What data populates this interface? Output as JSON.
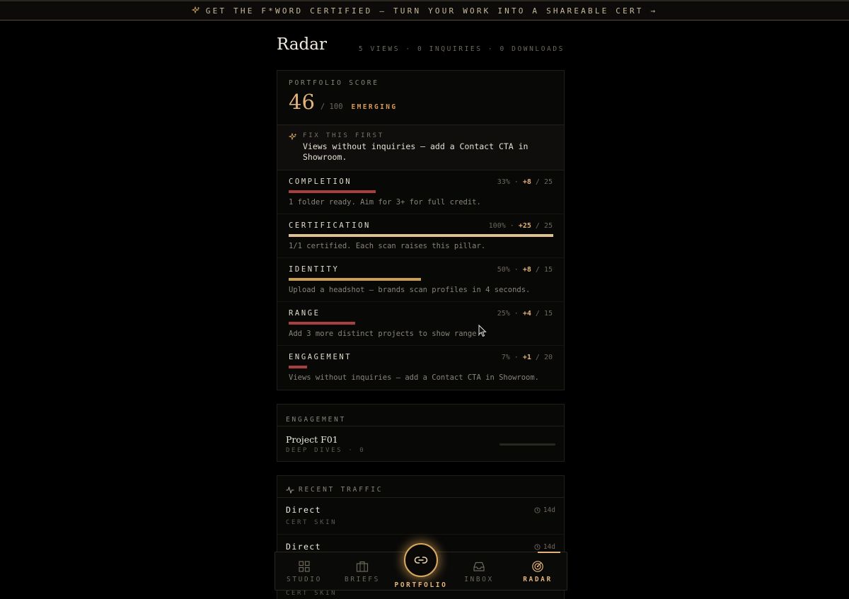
{
  "banner": {
    "text": "GET THE F*WORD CERTIFIED — TURN YOUR WORK INTO A SHAREABLE CERT →",
    "icon": "sparkle-icon"
  },
  "header": {
    "title": "Radar",
    "stats": "5 VIEWS · 0 INQUIRIES · 0 DOWNLOADS"
  },
  "score": {
    "label": "PORTFOLIO SCORE",
    "value": "46",
    "out_of": "/ 100",
    "tier": "EMERGING",
    "fix_label": "FIX THIS FIRST",
    "fix_line1": "Views without inquiries — add a Contact CTA in",
    "fix_line2": "Showroom."
  },
  "pillars": [
    {
      "name": "COMPLETION",
      "pct": "33%",
      "delta": "+8",
      "max": "/ 25",
      "fill": 0.33,
      "color": "#a84040",
      "note": "1 folder ready. Aim for 3+ for full credit."
    },
    {
      "name": "CERTIFICATION",
      "pct": "100%",
      "delta": "+25",
      "max": "/ 25",
      "fill": 1.0,
      "color": "#e0c090",
      "note": "1/1 certified. Each scan raises this pillar."
    },
    {
      "name": "IDENTITY",
      "pct": "50%",
      "delta": "+8",
      "max": "/ 15",
      "fill": 0.5,
      "color": "#c8a050",
      "note": "Upload a headshot — brands scan profiles in 4 seconds."
    },
    {
      "name": "RANGE",
      "pct": "25%",
      "delta": "+4",
      "max": "/ 15",
      "fill": 0.25,
      "color": "#a84040",
      "note": "Add 3 more distinct projects to show range."
    },
    {
      "name": "ENGAGEMENT",
      "pct": "7%",
      "delta": "+1",
      "max": "/ 20",
      "fill": 0.07,
      "color": "#a84040",
      "note": "Views without inquiries — add a Contact CTA in Showroom."
    }
  ],
  "engagement": {
    "heading": "ENGAGEMENT",
    "project": "Project F01",
    "sub": "DEEP DIVES · 0"
  },
  "traffic": {
    "heading": "RECENT TRAFFIC",
    "rows": [
      {
        "source": "Direct",
        "skin": "CERT SKIN",
        "ago": "14d"
      },
      {
        "source": "Direct",
        "skin": "CERT SKIN",
        "ago": "14d"
      }
    ]
  },
  "nav": {
    "items": [
      {
        "label": "STUDIO",
        "icon": "grid-icon"
      },
      {
        "label": "BRIEFS",
        "icon": "briefcase-icon"
      },
      {
        "label": "PORTFOLIO",
        "icon": "link-icon"
      },
      {
        "label": "INBOX",
        "icon": "inbox-icon"
      },
      {
        "label": "RADAR",
        "icon": "radar-icon"
      }
    ],
    "active": "RADAR"
  },
  "colors": {
    "accent": "#e2b27a",
    "warning": "#a84040",
    "background": "#000000"
  }
}
